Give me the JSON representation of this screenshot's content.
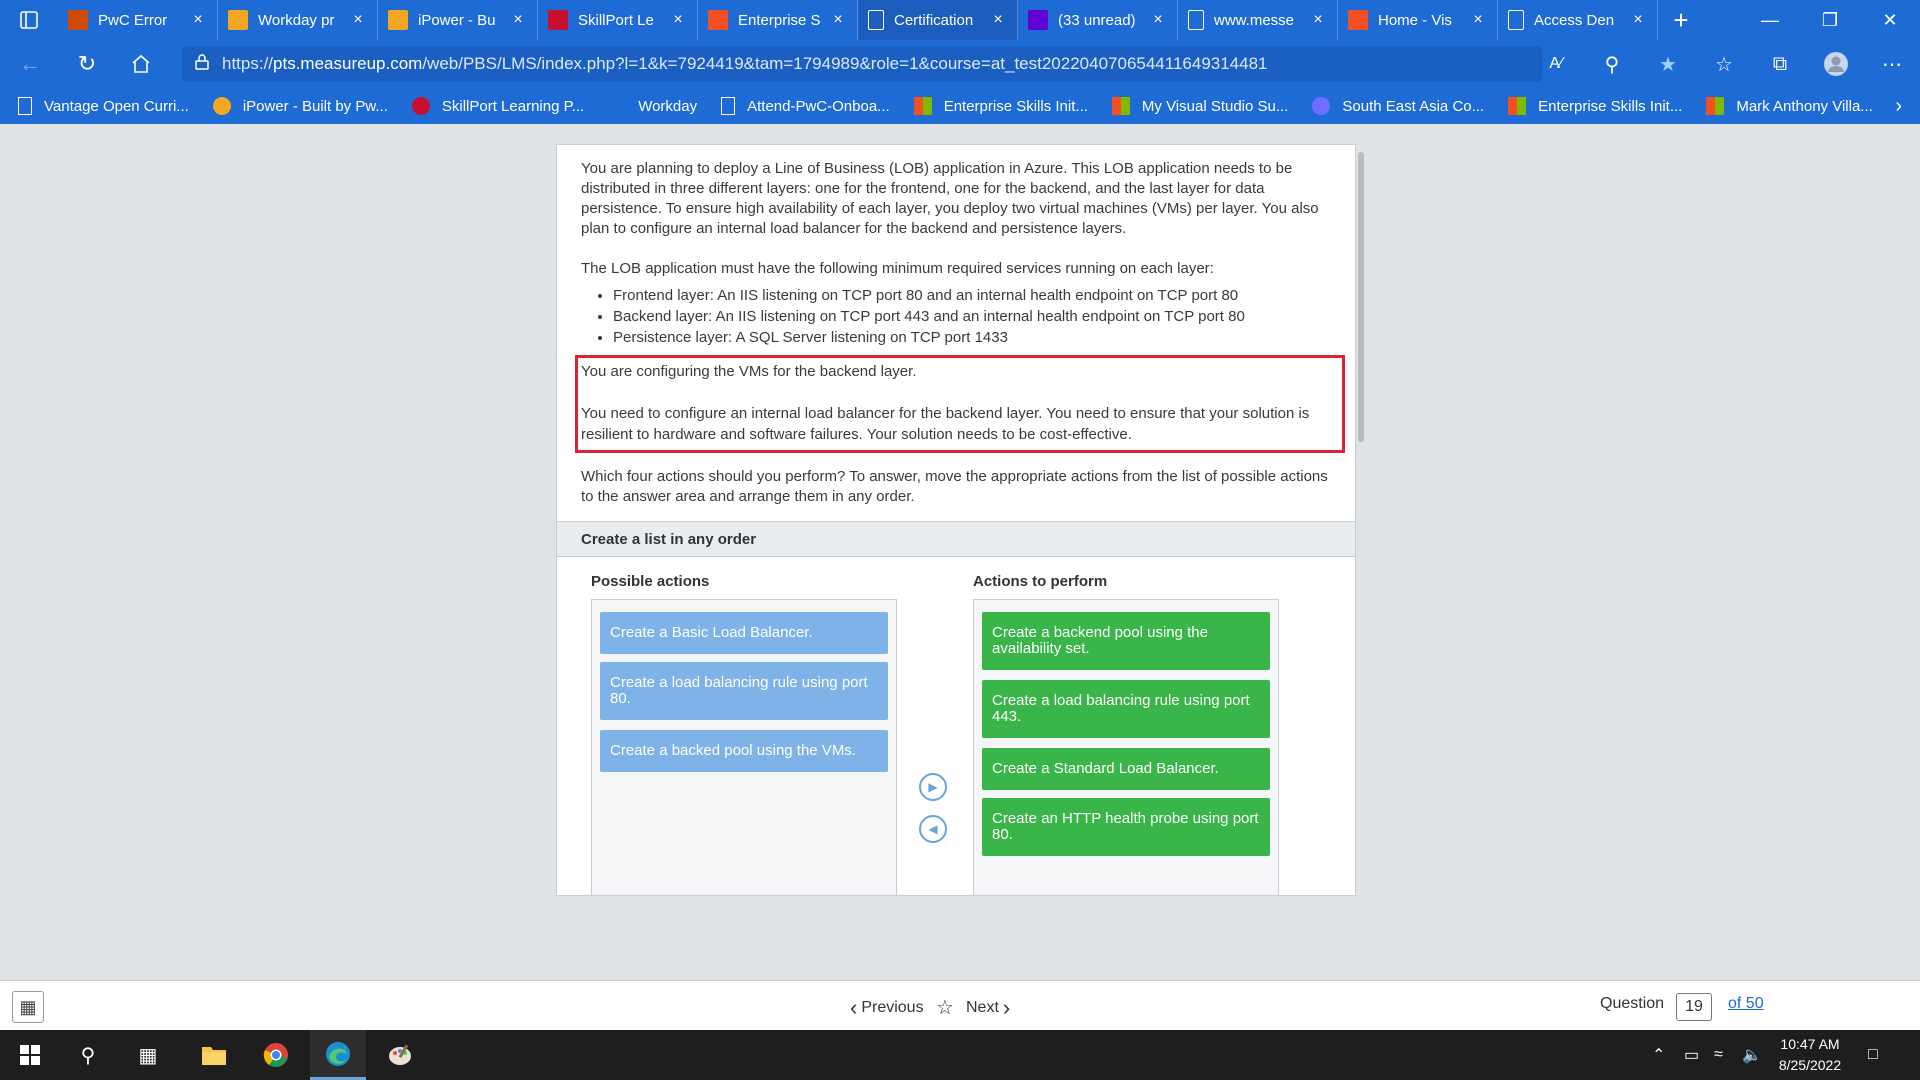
{
  "browser": {
    "tabs": [
      {
        "label": "PwC Error",
        "icon": "pwc-icon",
        "color": "#d04a02"
      },
      {
        "label": "Workday pr",
        "icon": "workday-icon",
        "color": "#f5a623"
      },
      {
        "label": "iPower - Bu",
        "icon": "ipower-icon",
        "color": "#f5a623"
      },
      {
        "label": "SkillPort Le",
        "icon": "skillport-icon",
        "color": "#c8102e"
      },
      {
        "label": "Enterprise S",
        "icon": "microsoft-icon",
        "color": "#f25022"
      },
      {
        "label": "Certification",
        "icon": "page-icon",
        "color": "#ffffff"
      },
      {
        "label": "(33 unread)",
        "icon": "mail-icon",
        "color": "#6001d2"
      },
      {
        "label": "www.messe",
        "icon": "download-icon",
        "color": "#ffffff"
      },
      {
        "label": "Home - Vis",
        "icon": "microsoft-icon",
        "color": "#f25022"
      },
      {
        "label": "Access Den",
        "icon": "page-icon",
        "color": "#ffffff"
      }
    ],
    "url_prefix": "https://",
    "url_domain": "pts.measureup.com",
    "url_path": "/web/PBS/LMS/index.php?l=1&k=7924419&tam=1794989&role=1&course=at_test20220407065441164931448⁠⁠⁠1",
    "bookmarks": [
      "Vantage Open Curri...",
      "iPower - Built by Pw...",
      "SkillPort Learning P...",
      "Workday",
      "Attend-PwC-Onboa...",
      "Enterprise Skills Init...",
      "My Visual Studio Su...",
      "South East Asia Co...",
      "Enterprise Skills Init...",
      "Mark Anthony Villa..."
    ]
  },
  "question": {
    "intro": "You are planning to deploy a Line of Business (LOB) application in Azure. This LOB application needs to be distributed in three different layers: one for the frontend, one for the backend, and the last layer for data persistence. To ensure high availability of each layer, you deploy two virtual machines (VMs) per layer. You also plan to configure an internal load balancer for the backend and persistence layers.",
    "requirements_intro": "The LOB application must have the following minimum required services running on each layer:",
    "requirements": [
      "Frontend layer: An IIS listening on TCP port 80 and an internal health endpoint on TCP port 80",
      "Backend layer: An IIS listening on TCP port 443 and an internal health endpoint on TCP port 80",
      "Persistence layer: A SQL Server listening on TCP port 1433"
    ],
    "highlight_1": "You are configuring the VMs for the backend layer.",
    "highlight_2": "You need to configure an internal load balancer for the backend layer. You need to ensure that your solution is resilient to hardware and software failures. Your solution needs to be cost-effective.",
    "prompt": "Which four actions should you perform? To answer, move the appropriate actions from the list of possible actions to the answer area and arrange them in any order."
  },
  "section_title": "Create a list in any order",
  "possible_actions": {
    "heading": "Possible actions",
    "items": [
      "Create a Basic Load Balancer.",
      "Create a load balancing rule using port 80.",
      "Create a backed pool using the VMs."
    ]
  },
  "actions_to_perform": {
    "heading": "Actions to perform",
    "items": [
      "Create a backend pool using the availability set.",
      "Create a load balancing rule using port 443.",
      "Create a Standard Load Balancer.",
      "Create an HTTP health probe using port 80."
    ]
  },
  "footer": {
    "previous": "Previous",
    "next": "Next",
    "question_label": "Question",
    "question_number": "19",
    "total": "of 50"
  },
  "taskbar": {
    "time": "10:47 AM",
    "date": "8/25/2022"
  }
}
